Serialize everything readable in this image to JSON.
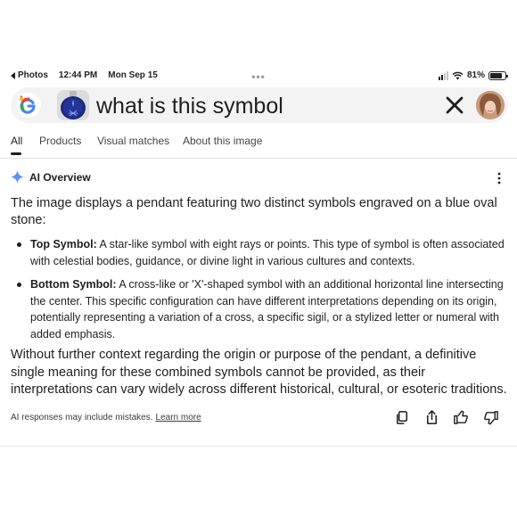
{
  "status_bar": {
    "back_app": "Photos",
    "time": "12:44 PM",
    "date": "Mon Sep 15",
    "battery": "81%",
    "battery_level": 0.81
  },
  "search": {
    "query": "what is this symbol"
  },
  "tabs": [
    "All",
    "Products",
    "Visual matches",
    "About this image"
  ],
  "ai_overview": {
    "title": "AI Overview",
    "intro": "The image displays a pendant featuring two distinct symbols engraved on a blue oval stone:",
    "points": [
      {
        "term": "Top Symbol:",
        "text": " A star-like symbol with eight rays or points. This type of symbol is often associated with celestial bodies, guidance, or divine light in various cultures and contexts."
      },
      {
        "term": "Bottom Symbol:",
        "text": " A cross-like or 'X'-shaped symbol with an additional horizontal line intersecting the center. This specific configuration can have different interpretations depending on its origin, potentially representing a variation of a cross, a specific sigil, or a stylized letter or numeral with added emphasis."
      }
    ],
    "closing": "Without further context regarding the origin or purpose of the pendant, a definitive single meaning for these combined symbols cannot be provided, as their interpretations can vary widely across different historical, cultural, or esoteric traditions.",
    "disclaimer": "AI responses may include mistakes.",
    "learn_more": "Learn more"
  },
  "colors": {
    "accent_blue": "#4285f4",
    "text": "#1f1f1f",
    "search_bg": "#f3f3f3"
  },
  "icons": [
    "google-lens-logo",
    "close-icon",
    "more-vert-icon",
    "sparkle-icon",
    "copy-icon",
    "share-icon",
    "thumbs-up-icon",
    "thumbs-down-icon",
    "wifi-icon",
    "signal-icon",
    "battery-icon"
  ]
}
